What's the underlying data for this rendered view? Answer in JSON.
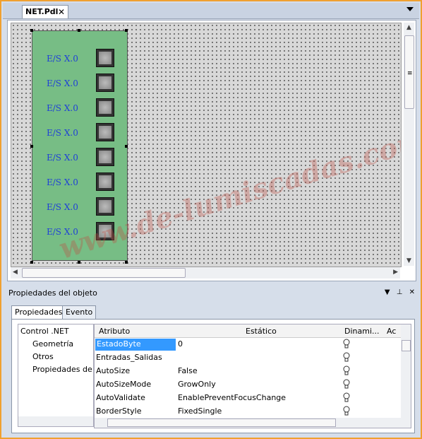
{
  "document": {
    "tab_label": "NET.Pdl",
    "close_glyph": "✕"
  },
  "canvas": {
    "io_rows": [
      {
        "label": "E/S X.0"
      },
      {
        "label": "E/S X.0"
      },
      {
        "label": "E/S X.0"
      },
      {
        "label": "E/S X.0"
      },
      {
        "label": "E/S X.0"
      },
      {
        "label": "E/S X.0"
      },
      {
        "label": "E/S X.0"
      },
      {
        "label": "E/S X.0"
      }
    ],
    "watermark": "www.de-lumiscadas.com",
    "panel_color": "#77bd85",
    "label_color": "#1e3fd8"
  },
  "properties": {
    "title": "Propiedades del objeto",
    "tabs": [
      {
        "label": "Propiedades"
      },
      {
        "label": "Evento"
      }
    ],
    "tree": {
      "root": "Control .NET",
      "children": [
        {
          "label": "Geometría"
        },
        {
          "label": "Otros"
        },
        {
          "label": "Propiedades de"
        }
      ]
    },
    "columns": {
      "attribute": "Atributo",
      "static": "Estático",
      "dynamic": "Dinami...",
      "action": "Ac"
    },
    "rows": [
      {
        "name": "EstadoByte",
        "value": "0",
        "selected": true
      },
      {
        "name": "Entradas_Salidas",
        "value": ""
      },
      {
        "name": "AutoSize",
        "value": "False"
      },
      {
        "name": "AutoSizeMode",
        "value": "GrowOnly"
      },
      {
        "name": "AutoValidate",
        "value": "EnablePreventFocusChange"
      },
      {
        "name": "BorderStyle",
        "value": "FixedSingle"
      }
    ]
  }
}
